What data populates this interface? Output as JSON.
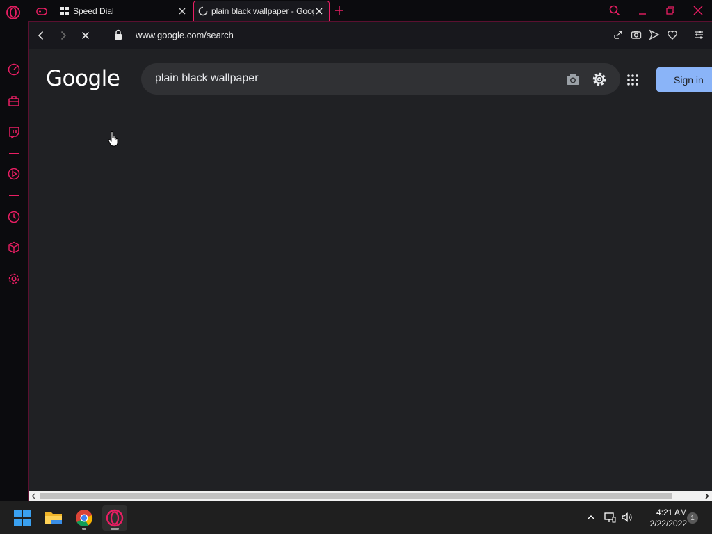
{
  "colors": {
    "accent": "#e91e63",
    "page_bg": "#202124",
    "chrome_bg": "#0b0b0e",
    "signin_bg": "#8ab4f8"
  },
  "tabs": [
    {
      "title": "Speed Dial",
      "icon": "speed-dial-icon"
    },
    {
      "title": "plain black wallpaper - Google Search",
      "icon": "loading-spinner-icon"
    }
  ],
  "address_bar": {
    "url": "www.google.com/search"
  },
  "google": {
    "logo": "Google",
    "query": "plain black wallpaper",
    "signin_label": "Sign in"
  },
  "taskbar": {
    "time": "4:21 AM",
    "date": "2/22/2022",
    "notifications": "1"
  }
}
